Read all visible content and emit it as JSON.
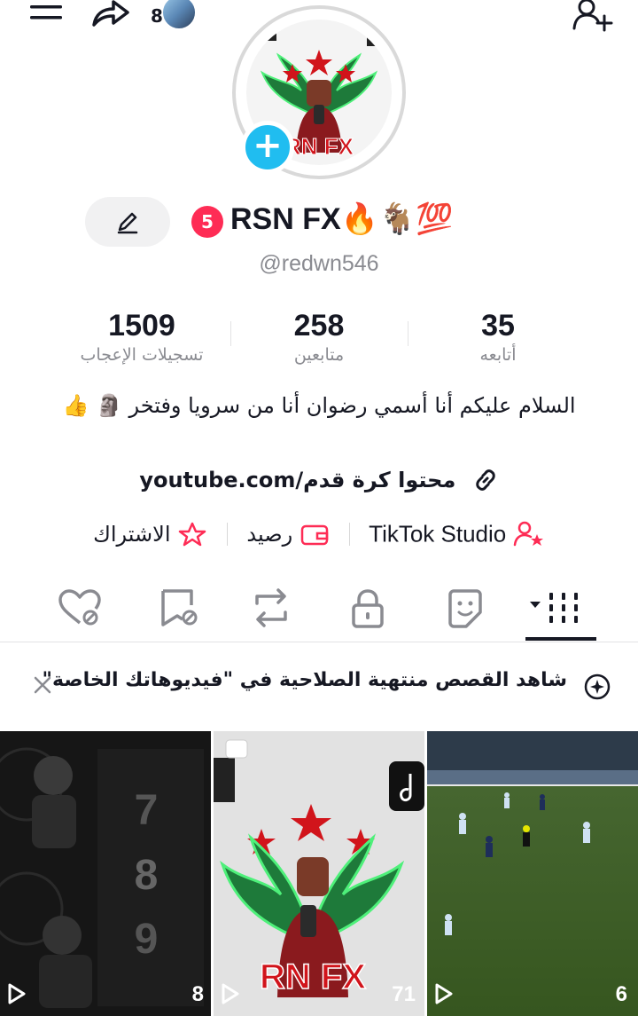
{
  "header": {
    "menu_icon": "menu-icon",
    "share_icon": "share-icon",
    "mini_avatar_count": "8",
    "add_friend_icon": "add-friend-icon"
  },
  "profile": {
    "avatar_overlay_text": "RN FX",
    "badge_count": "5",
    "display_name": "RSN FX🔥🐐💯",
    "username": "@redwn546"
  },
  "stats": {
    "likes": {
      "value": "1509",
      "label": "تسجيلات الإعجاب"
    },
    "followers": {
      "value": "258",
      "label": "متابعين"
    },
    "following": {
      "value": "35",
      "label": "أتابعه"
    }
  },
  "bio": {
    "text": "السلام عليكم أنا أسمي رضوان أنا من سرويا وفتخر 🗿 👍",
    "link": "youtube.com/محتوا كرة قدم"
  },
  "actions": {
    "studio": "TikTok Studio",
    "balance": "رصيد",
    "subscription": "الاشتراك"
  },
  "banner": {
    "text": "شاهد القصص منتهية الصلاحية في \"فيديوهاتك الخاصة\""
  },
  "videos": [
    {
      "views": "8",
      "overlay": [
        "7",
        "8",
        "9"
      ]
    },
    {
      "views": "71",
      "overlay": [
        "RN FX"
      ]
    },
    {
      "views": "6",
      "overlay": []
    }
  ],
  "colors": {
    "accent": "#fe2c55",
    "plus_blue": "#20bdf0",
    "text_primary": "#161823",
    "text_secondary": "#8a8b91"
  }
}
